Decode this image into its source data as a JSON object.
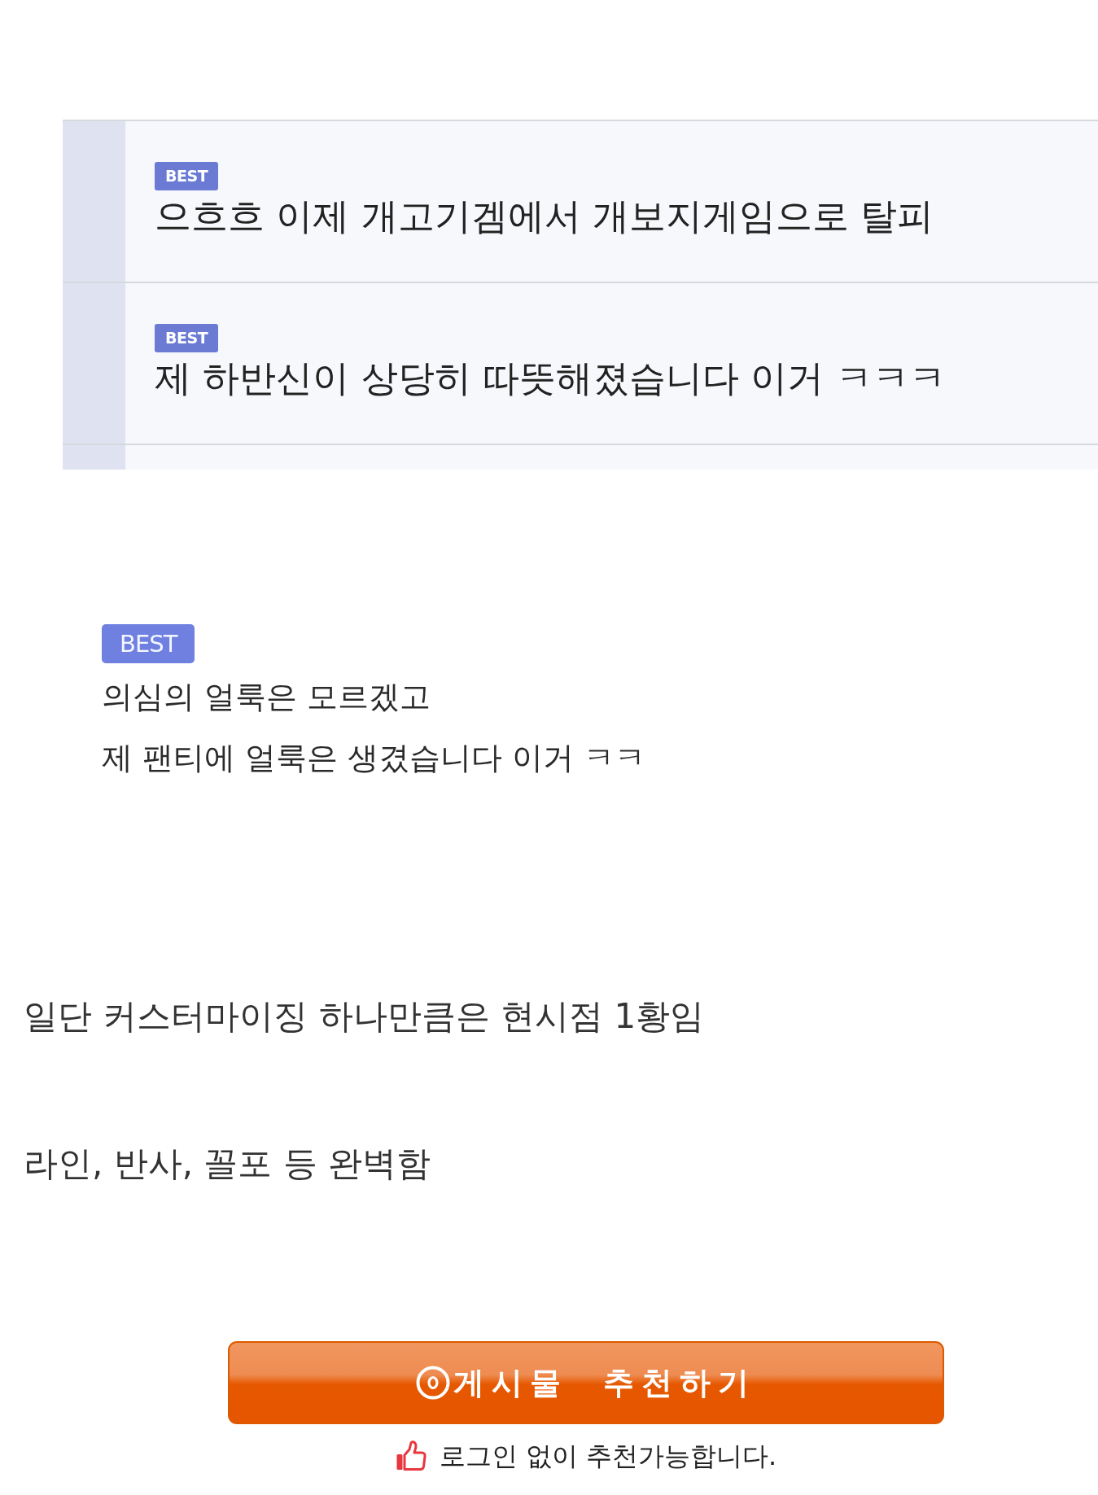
{
  "comment_screenshot": {
    "comments": [
      {
        "badge": "BEST",
        "text": "으흐흐 이제 개고기겜에서 개보지게임으로 탈피"
      },
      {
        "badge": "BEST",
        "text": "제 하반신이 상당히 따뜻해졌습니다 이거 ㅋㅋㅋ"
      }
    ]
  },
  "comment_screenshot_2": {
    "badge": "BEST",
    "lines": [
      "의심의 얼룩은 모르겠고",
      "제 팬티에 얼룩은 생겼습니다 이거 ㅋㅋ"
    ]
  },
  "paragraphs": [
    "일단 커스터마이징 하나만큼은 현시점 1황임",
    "라인, 반사, 꼴포 등 완벽함"
  ],
  "recommend_button": {
    "label": "게시물 추천하기"
  },
  "recommend_note": "로그인 없이 추천가능합니다."
}
